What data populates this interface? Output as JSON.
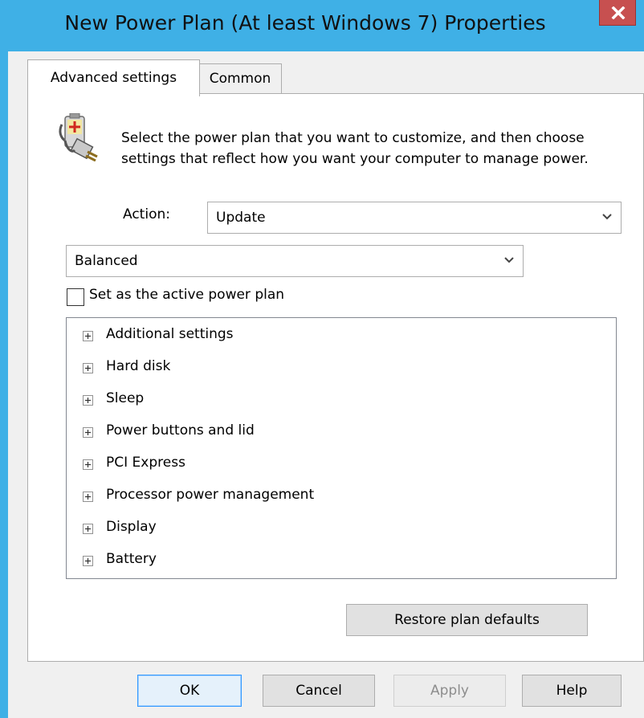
{
  "window": {
    "title": "New Power Plan (At least Windows 7) Properties",
    "title_bar_color": "#3fb0e6",
    "close_button_color": "#c75050"
  },
  "tabs": [
    {
      "label": "Advanced settings",
      "selected": true
    },
    {
      "label": "Common",
      "selected": false
    }
  ],
  "description": "Select the power plan that you want to customize, and then choose settings that reflect how you want your computer to manage power.",
  "action": {
    "label": "Action:",
    "value": "Update"
  },
  "plan": {
    "value": "Balanced"
  },
  "active_plan_checkbox": {
    "label": "Set as the active power plan",
    "checked": false
  },
  "settings_tree": [
    {
      "label": "Additional settings",
      "icon": "plus-expander-icon"
    },
    {
      "label": "Hard disk",
      "icon": "plus-expander-icon"
    },
    {
      "label": "Sleep",
      "icon": "plus-expander-icon"
    },
    {
      "label": "Power buttons and lid",
      "icon": "plus-expander-icon"
    },
    {
      "label": "PCI Express",
      "icon": "plus-expander-icon"
    },
    {
      "label": "Processor power management",
      "icon": "plus-expander-icon"
    },
    {
      "label": "Display",
      "icon": "plus-expander-icon"
    },
    {
      "label": "Battery",
      "icon": "plus-expander-icon"
    }
  ],
  "buttons": {
    "restore": "Restore plan defaults",
    "ok": "OK",
    "cancel": "Cancel",
    "apply": "Apply",
    "help": "Help"
  },
  "apply_disabled": true
}
